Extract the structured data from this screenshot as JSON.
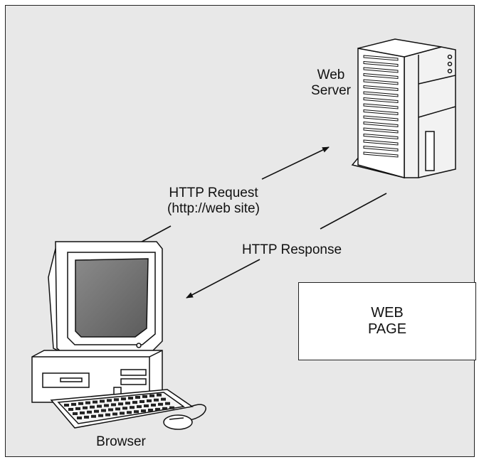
{
  "server_label": {
    "line1": "Web",
    "line2": "Server"
  },
  "request_label": {
    "line1": "HTTP Request",
    "line2": "(http://web site)"
  },
  "response_label": "HTTP Response",
  "client_label": "Browser",
  "web_page_box": {
    "line1": "WEB",
    "line2": "PAGE"
  },
  "colors": {
    "background": "#e8e8e8",
    "stroke": "#111111",
    "box": "#ffffff",
    "screen": "#7a7a7a"
  }
}
